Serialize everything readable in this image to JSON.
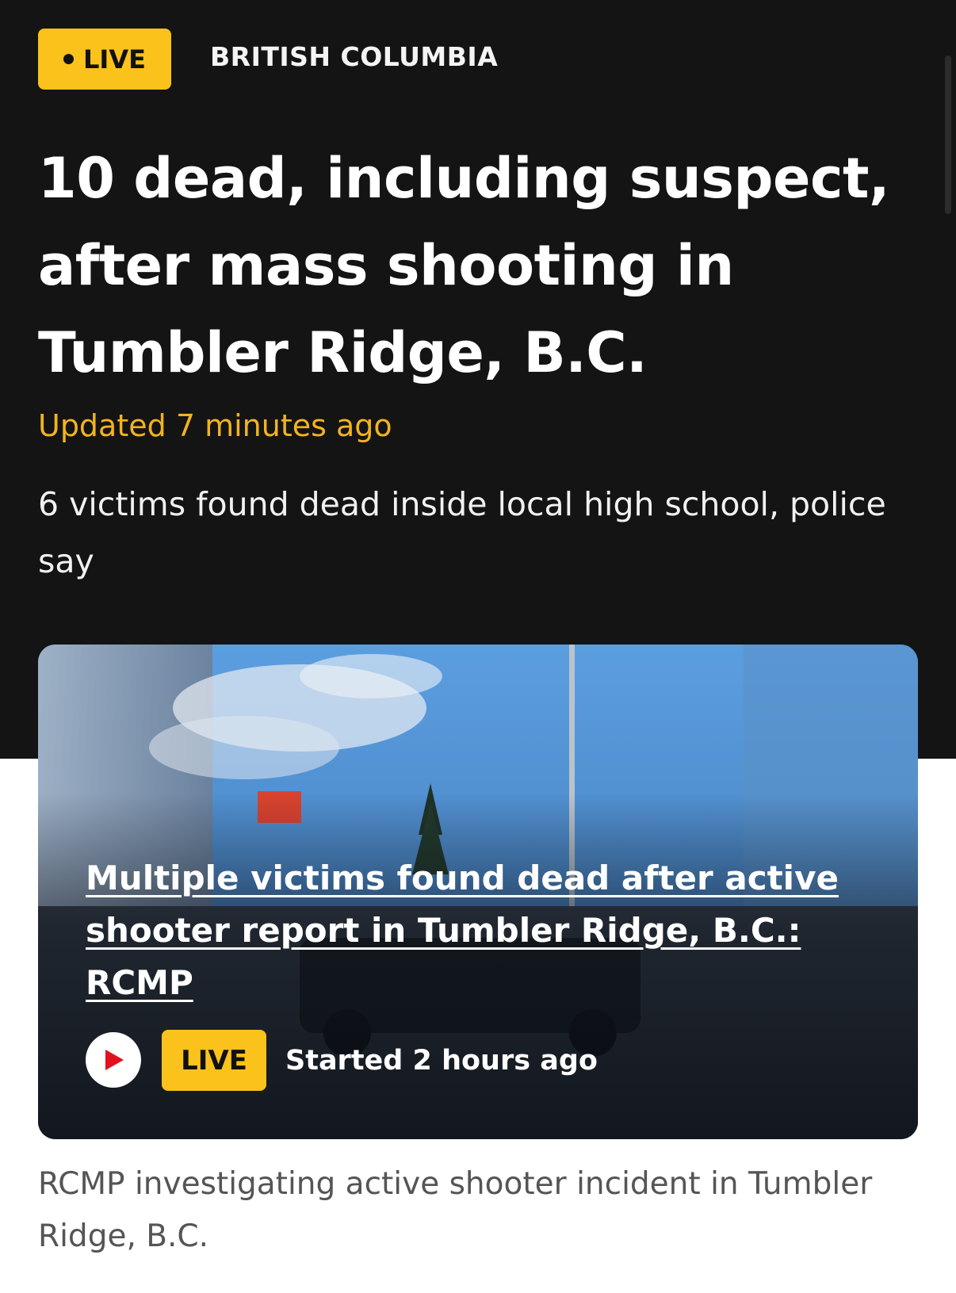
{
  "header": {
    "live_label": "LIVE",
    "section": "BRITISH COLUMBIA"
  },
  "article": {
    "headline": "10 dead, including suspect, after mass shooting in Tumbler Ridge, B.C.",
    "updated": "Updated 7 minutes ago",
    "deck": "6 victims found dead inside local high school, police say"
  },
  "video_card": {
    "title": "Multiple victims found dead after active shooter report in Tumbler Ridge, B.C.: RCMP",
    "live_label": "LIVE",
    "started": "Started 2 hours ago",
    "caption": "RCMP investigating active shooter incident in Tumbler Ridge, B.C."
  },
  "colors": {
    "background_dark": "#141414",
    "accent_yellow": "#fcc21c",
    "updated_text": "#f2b321",
    "play_icon_red": "#e3101e"
  },
  "icons": {
    "play": "play-icon"
  }
}
